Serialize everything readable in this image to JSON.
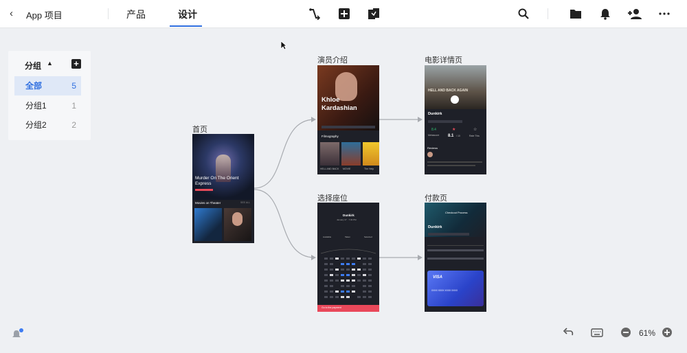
{
  "topbar": {
    "back_glyph": "‹",
    "app_title": "App 项目",
    "tabs": [
      {
        "label": "产品",
        "active": false
      },
      {
        "label": "设计",
        "active": true
      }
    ],
    "tools": [
      "link-icon",
      "add-square-icon",
      "screens-icon"
    ],
    "right_tools": [
      "search-icon",
      "folder-icon",
      "bell-icon",
      "add-user-icon",
      "more-icon"
    ],
    "accent": "#2f6fe0"
  },
  "sidebar": {
    "header": "分组",
    "add_label": "+",
    "items": [
      {
        "label": "全部",
        "count": "5",
        "active": true
      },
      {
        "label": "分组1",
        "count": "1",
        "active": false
      },
      {
        "label": "分组2",
        "count": "2",
        "active": false
      }
    ]
  },
  "screens": {
    "home": {
      "label": "首页",
      "movie_title": "Murder On The Orient Express",
      "section": "Movies on Theater",
      "see_all": "SEE ALL"
    },
    "actor": {
      "label": "演员介绍",
      "name": "Khloe Kardashian",
      "section": "Filmography",
      "films": [
        "HELL AND BACK",
        "MOVIE",
        "The Help"
      ]
    },
    "detail": {
      "label": "电影详情页",
      "poster_title": "HELL AND BACK AGAIN",
      "movie": "Dunkirk",
      "metascore_value": "8.4",
      "metascore_label": "Metascore",
      "rating_value": "8.1",
      "rating_suffix": "/ 10",
      "rate_label": "Rate This",
      "reviews": "Reviews"
    },
    "seat": {
      "label": "选择座位",
      "movie": "Dunkirk",
      "date": "January 27 · 7:30 PM",
      "legend": [
        "Available",
        "Taken",
        "Selected"
      ],
      "cta": "Go to the payment"
    },
    "pay": {
      "label": "付款页",
      "header": "Checkout Process",
      "movie": "Dunkirk",
      "card_brand": "VISA",
      "card_number": "XXXX  XXXX  XXXX  XXXX"
    }
  },
  "bottom": {
    "zoom": "61%",
    "tools": [
      "undo-icon",
      "keyboard-icon",
      "zoom-out-icon",
      "zoom-in-icon"
    ]
  }
}
